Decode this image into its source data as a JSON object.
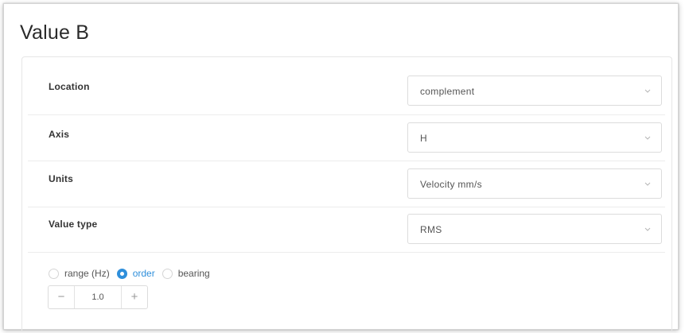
{
  "section": {
    "title": "Value B"
  },
  "fields": [
    {
      "label": "Location",
      "value": "complement"
    },
    {
      "label": "Axis",
      "value": "H"
    },
    {
      "label": "Units",
      "value": "Velocity mm/s"
    },
    {
      "label": "Value type",
      "value": "RMS"
    }
  ],
  "mode": {
    "options": [
      "range (Hz)",
      "order",
      "bearing"
    ],
    "selected": "order"
  },
  "stepper": {
    "minus": "−",
    "value": "1.0",
    "plus": "+"
  },
  "colors": {
    "accent": "#2f8fdb",
    "border": "#dcdcdc",
    "text": "#333333"
  },
  "icons": {
    "dropdown": "chevron-down-icon"
  }
}
